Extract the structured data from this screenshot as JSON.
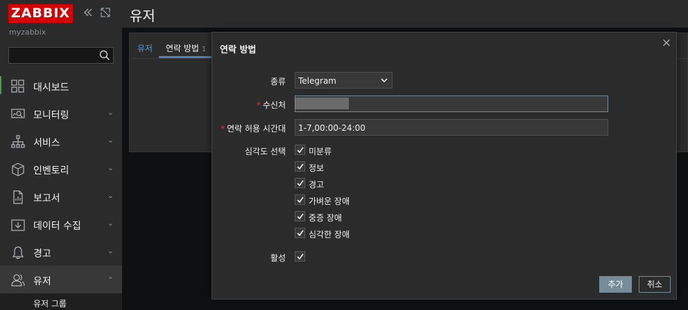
{
  "sidebar": {
    "logo": "ZABBIX",
    "server_name": "myzabbix",
    "collapse_icon": "double-chevron-left-icon",
    "kiosk_icon": "expand-icon",
    "search_placeholder": "",
    "items": [
      {
        "label": "대시보드",
        "icon": "dashboard-icon",
        "mark_color": "#44a047"
      },
      {
        "label": "모니터링",
        "icon": "monitoring-icon",
        "chevron": "⌄"
      },
      {
        "label": "서비스",
        "icon": "services-icon",
        "chevron": "⌄"
      },
      {
        "label": "인벤토리",
        "icon": "inventory-icon",
        "chevron": "⌄"
      },
      {
        "label": "보고서",
        "icon": "reports-icon",
        "chevron": "⌄"
      },
      {
        "label": "데이터 수집",
        "icon": "data-collection-icon",
        "chevron": "⌄"
      },
      {
        "label": "경고",
        "icon": "alerts-icon",
        "chevron": "⌄"
      },
      {
        "label": "유저",
        "icon": "users-icon",
        "chevron": "⌃"
      }
    ],
    "sub_item": "유저 그룹"
  },
  "header": {
    "title": "유저"
  },
  "background_tabs": [
    {
      "label": "유저"
    },
    {
      "label": "연락 방법",
      "count": "1"
    }
  ],
  "modal": {
    "title": "연락 방법",
    "close_label": "×",
    "fields": {
      "type_label": "종류",
      "type_value": "Telegram",
      "sendto_label": "수신처",
      "sendto_value": "",
      "period_label": "연락 허용 시간대",
      "period_value": "1-7,00:00-24:00",
      "severity_label": "심각도 선택",
      "active_label": "활성"
    },
    "severities": [
      {
        "label": "미분류",
        "checked": true
      },
      {
        "label": "정보",
        "checked": true
      },
      {
        "label": "경고",
        "checked": true
      },
      {
        "label": "가벼운 장애",
        "checked": true
      },
      {
        "label": "중증 장애",
        "checked": true
      },
      {
        "label": "심각한 장애",
        "checked": true
      }
    ],
    "active_checked": true,
    "buttons": {
      "add": "추가",
      "cancel": "취소"
    }
  },
  "colors": {
    "accent": "#768d99",
    "logo": "#d40000",
    "required": "#e33734"
  }
}
